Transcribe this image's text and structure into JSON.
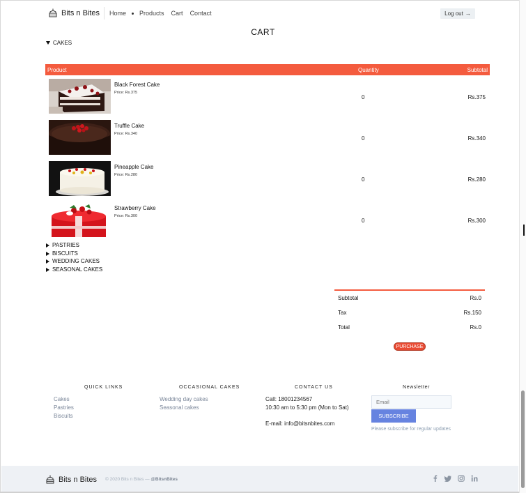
{
  "brand": {
    "name": "Bits n Bites"
  },
  "nav": {
    "home": "Home",
    "products": "Products",
    "cart": "Cart",
    "contact": "Contact",
    "logout": "Log out",
    "logout_arrow": "→"
  },
  "page": {
    "title": "CART"
  },
  "categories": {
    "open": "CAKES",
    "collapsed": [
      "PASTRIES",
      "BISCUITS",
      "WEDDING CAKES",
      "SEASONAL CAKES"
    ]
  },
  "table": {
    "headers": {
      "product": "Product",
      "quantity": "Quantity",
      "subtotal": "Subtotal"
    },
    "rows": [
      {
        "name": "Black Forest Cake",
        "price": "Price: Rs.375",
        "qty": "0",
        "subtotal": "Rs.375"
      },
      {
        "name": "Truffle Cake",
        "price": "Price: Rs.340",
        "qty": "0",
        "subtotal": "Rs.340"
      },
      {
        "name": "Pineapple Cake",
        "price": "Price: Rs.280",
        "qty": "0",
        "subtotal": "Rs.280"
      },
      {
        "name": "Strawberry Cake",
        "price": "Price: Rs.300",
        "qty": "0",
        "subtotal": "Rs.300"
      }
    ]
  },
  "totals": {
    "subtotal_label": "Subtotal",
    "subtotal_value": "Rs.0",
    "tax_label": "Tax",
    "tax_value": "Rs.150",
    "total_label": "Total",
    "total_value": "Rs.0",
    "purchase": "PURCHASE"
  },
  "footer": {
    "quick_links": {
      "heading": "QUICK LINKS",
      "links": [
        "Cakes",
        "Pastries",
        "Biscuits"
      ]
    },
    "occasional": {
      "heading": "OCCASIONAL CAKES",
      "links": [
        "Wedding day cakes",
        "Seasonal cakes"
      ]
    },
    "contact": {
      "heading": "CONTACT US",
      "call": "Call: 18001234567",
      "hours": "10:30 am to 5:30 pm (Mon to Sat)",
      "email": "E-mail: info@bitsnbites.com"
    },
    "newsletter": {
      "heading": "Newsletter",
      "placeholder": "Email",
      "button": "SUBSCRIBE",
      "note": "Please subscribe for regular updates"
    }
  },
  "bottom": {
    "brand": "Bits n Bites",
    "copyright": "© 2020 Bits n Bites —",
    "handle": "@BitsnBites"
  },
  "social_icons": [
    "facebook-icon",
    "twitter-icon",
    "instagram-icon",
    "linkedin-icon"
  ],
  "colors": {
    "accent": "#f45b3e",
    "subscribe": "#6683e0",
    "link": "#7a8699"
  }
}
